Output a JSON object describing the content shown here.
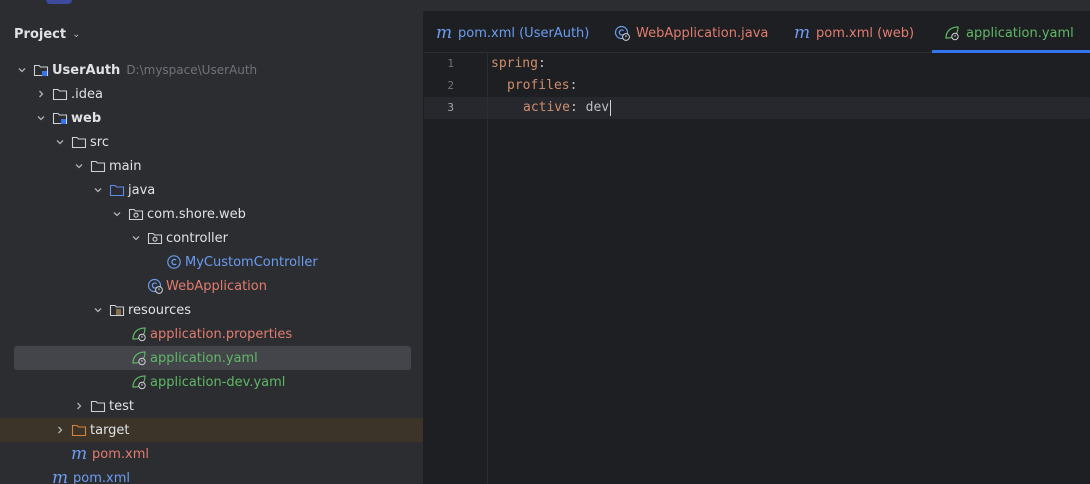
{
  "panel": {
    "title": "Project"
  },
  "tree": {
    "root_label": "UserAuth",
    "root_path": "D:\\myspace\\UserAuth",
    "idea": ".idea",
    "web": "web",
    "src": "src",
    "main": "main",
    "java": "java",
    "package": "com.shore.web",
    "controller_pkg": "controller",
    "my_controller": "MyCustomController",
    "web_application": "WebApplication",
    "resources": "resources",
    "app_properties": "application.properties",
    "app_yaml": "application.yaml",
    "app_dev_yaml": "application-dev.yaml",
    "test": "test",
    "target": "target",
    "web_pom": "pom.xml",
    "root_pom": "pom.xml"
  },
  "tabs": [
    {
      "label": "pom.xml (UserAuth)"
    },
    {
      "label": "WebApplication.java"
    },
    {
      "label": "pom.xml (web)"
    },
    {
      "label": "application.yaml"
    }
  ],
  "editor": {
    "line_numbers": [
      "1",
      "2",
      "3"
    ],
    "lines": [
      {
        "key": "spring",
        "colon": ":",
        "value": ""
      },
      {
        "key": "profiles",
        "colon": ":",
        "value": ""
      },
      {
        "key": "active",
        "colon": ":",
        "value": " dev"
      }
    ]
  },
  "colors": {
    "accent": "#3574f0",
    "file_modified": "#5fb865",
    "file_error": "#e27c6e",
    "yaml_key": "#cf8e6d"
  },
  "icons": {
    "folder": "folder-icon",
    "module": "module-folder-icon",
    "package": "package-icon",
    "class": "class-icon",
    "spring_boot": "spring-boot-icon",
    "spring_config": "spring-config-icon",
    "maven": "maven-icon"
  }
}
